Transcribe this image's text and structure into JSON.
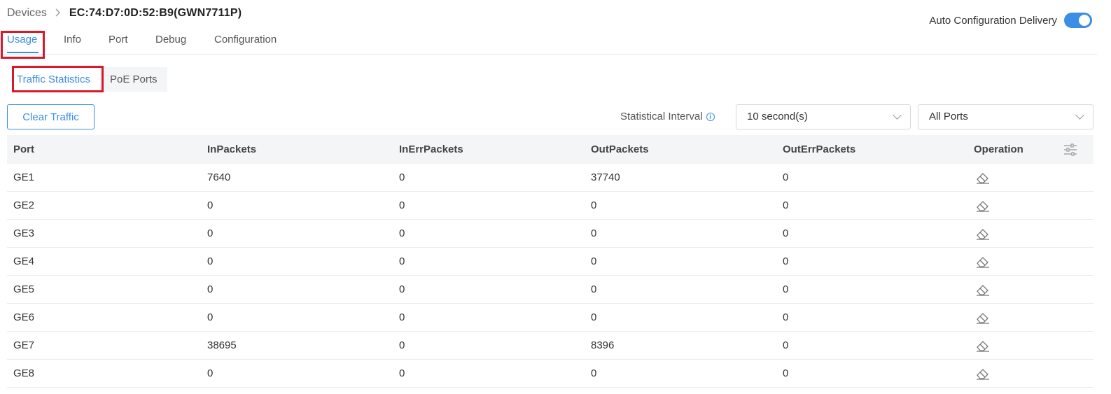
{
  "breadcrumb": {
    "parent": "Devices",
    "separator": ">",
    "current": "EC:74:D7:0D:52:B9(GWN7711P)"
  },
  "auto_config": {
    "label": "Auto Configuration Delivery",
    "enabled": true
  },
  "tabs": [
    {
      "label": "Usage",
      "active": true
    },
    {
      "label": "Info",
      "active": false
    },
    {
      "label": "Port",
      "active": false
    },
    {
      "label": "Debug",
      "active": false
    },
    {
      "label": "Configuration",
      "active": false
    }
  ],
  "subtabs": [
    {
      "label": "Traffic Statistics",
      "active": true
    },
    {
      "label": "PoE Ports",
      "active": false
    }
  ],
  "toolbar": {
    "clear_label": "Clear Traffic",
    "interval_label": "Statistical Interval",
    "interval_info_icon": "info-icon",
    "interval_value": "10 second(s)",
    "ports_value": "All Ports"
  },
  "table": {
    "columns": [
      "Port",
      "InPackets",
      "InErrPackets",
      "OutPackets",
      "OutErrPackets",
      "Operation"
    ],
    "column_settings_icon": "sliders-icon",
    "row_action_icon": "eraser-icon",
    "rows": [
      [
        "GE1",
        "7640",
        "0",
        "37740",
        "0"
      ],
      [
        "GE2",
        "0",
        "0",
        "0",
        "0"
      ],
      [
        "GE3",
        "0",
        "0",
        "0",
        "0"
      ],
      [
        "GE4",
        "0",
        "0",
        "0",
        "0"
      ],
      [
        "GE5",
        "0",
        "0",
        "0",
        "0"
      ],
      [
        "GE6",
        "0",
        "0",
        "0",
        "0"
      ],
      [
        "GE7",
        "38695",
        "0",
        "8396",
        "0"
      ],
      [
        "GE8",
        "0",
        "0",
        "0",
        "0"
      ]
    ]
  },
  "colors": {
    "accent": "#3a8ee6",
    "highlight": "#d7192a",
    "header_bg": "#f4f5f7"
  }
}
